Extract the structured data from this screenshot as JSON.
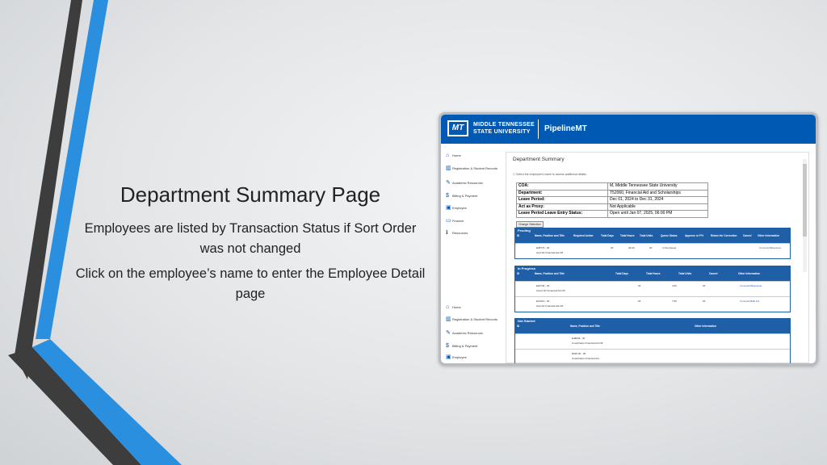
{
  "slide": {
    "title": "Department Summary Page",
    "line1": "Employees are listed by Transaction Status if Sort Order was not changed",
    "line2": "Click on the employee’s name to enter the Employee Detail page"
  },
  "colors": {
    "accent_blue": "#0059b3",
    "stripe_blue": "#2b8fe0",
    "stripe_dark": "#3d3d3d"
  },
  "app": {
    "logo": "MT",
    "university_line1": "MIDDLE TENNESSEE",
    "university_line2": "STATE UNIVERSITY",
    "name": "PipelineMT"
  },
  "nav": [
    {
      "icon": "home-icon",
      "glyph": "⌂",
      "label": "Home"
    },
    {
      "icon": "building-icon",
      "glyph": "▥",
      "label": "Registration & Student Records"
    },
    {
      "icon": "pencil-icon",
      "glyph": "✎",
      "label": "Academic Resources"
    },
    {
      "icon": "dollar-icon",
      "glyph": "$",
      "label": "Billing & Payment"
    },
    {
      "icon": "badge-icon",
      "glyph": "▣",
      "label": "Employee"
    },
    {
      "icon": "money-icon",
      "glyph": "▭",
      "label": "Finance"
    },
    {
      "icon": "info-icon",
      "glyph": "ℹ",
      "label": "Resources"
    }
  ],
  "nav_repeat": [
    {
      "icon": "home-icon",
      "glyph": "⌂",
      "label": "Home"
    },
    {
      "icon": "building-icon",
      "glyph": "▥",
      "label": "Registration & Student Records"
    },
    {
      "icon": "pencil-icon",
      "glyph": "✎",
      "label": "Academic Resources"
    },
    {
      "icon": "dollar-icon",
      "glyph": "$",
      "label": "Billing & Payment"
    },
    {
      "icon": "badge-icon",
      "glyph": "▣",
      "label": "Employee"
    }
  ],
  "summary": {
    "title": "Department Summary",
    "hint": "Select the employee's name to access additional details.",
    "info": [
      {
        "k": "COA:",
        "v": "M, Middle Tennessee State University"
      },
      {
        "k": "Department:",
        "v": "T52060, Financial Aid and Scholarships"
      },
      {
        "k": "Leave Period:",
        "v": "Dec 01, 2024 to Dec 31, 2024"
      },
      {
        "k": "Act as Proxy:",
        "v": "Not Applicable"
      },
      {
        "k": "Leave Period Leave Entry Status:",
        "v": "Open until Jan 07, 2025, 06:00 PM"
      }
    ],
    "change_button": "Change Selection"
  },
  "pending": {
    "title": "Pending",
    "cols": [
      "ID",
      "Name, Position and Title",
      "Required Action",
      "Total Days",
      "Total Hours",
      "Total Units",
      "Queue Status",
      "Approve or FYI",
      "Return for Correction",
      "Cancel",
      "Other Information"
    ],
    "rows": [
      {
        "id": "",
        "name": "E38776 - 00",
        "title": "Asst Dir Financial Aid Off",
        "days": "20",
        "hours": "40.00",
        "units": "20",
        "queue": "In the Queue",
        "other": "Comment/Response"
      }
    ]
  },
  "in_progress": {
    "title": "In Progress",
    "cols": [
      "ID",
      "Name, Position and Title",
      "Total Days",
      "Total Hours",
      "Total Units",
      "Cancel",
      "Other Information"
    ],
    "rows": [
      {
        "name": "E00746 - 00",
        "title": "Assoc Dir Financial Aid Off",
        "days": "20",
        "hours": "4.00",
        "units": "20",
        "other": "Comment/Response"
      },
      {
        "name": "E14010 - 00",
        "title": "Asst Dir Financial Aid Off",
        "days": "20",
        "hours": "7.50",
        "units": "20",
        "other": "Comment/Edit Ind"
      }
    ]
  },
  "not_started": {
    "title": "Not Started",
    "cols": [
      "ID",
      "Name, Position and Title",
      "Other Information"
    ],
    "rows": [
      {
        "name": "E48049 - 00",
        "title": "Coordinator Financial Aid Off"
      },
      {
        "name": "E648 00 - 00",
        "title": "Coordinator Financial Aid"
      }
    ]
  }
}
